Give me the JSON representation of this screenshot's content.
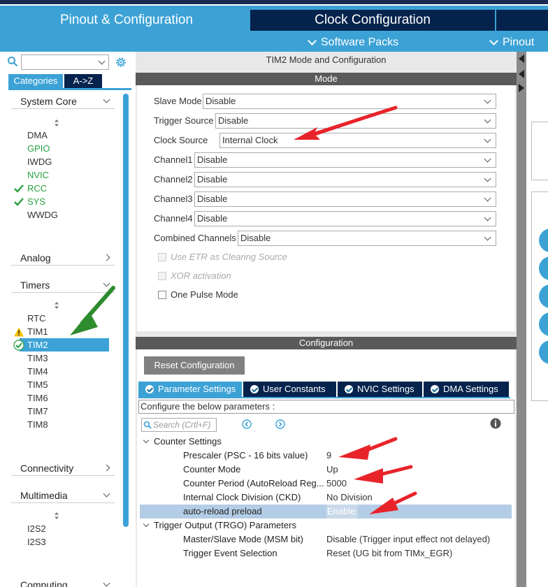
{
  "header": {
    "tab_pinout": "Pinout & Configuration",
    "tab_clock": "Clock Configuration",
    "sub_software_packs": "Software Packs",
    "sub_pinout": "Pinout"
  },
  "left_panel": {
    "search_value": "",
    "tab_categories": "Categories",
    "tab_az": "A->Z",
    "groups": {
      "system_core": "System Core",
      "analog": "Analog",
      "timers": "Timers",
      "connectivity": "Connectivity",
      "multimedia": "Multimedia",
      "computing": "Computing"
    },
    "system_core_items": [
      "DMA",
      "GPIO",
      "IWDG",
      "NVIC",
      "RCC",
      "SYS",
      "WWDG"
    ],
    "timer_items": [
      "RTC",
      "TIM1",
      "TIM2",
      "TIM3",
      "TIM4",
      "TIM5",
      "TIM6",
      "TIM7",
      "TIM8"
    ],
    "multimedia_items": [
      "I2S2",
      "I2S3"
    ]
  },
  "mode_panel": {
    "title": "TIM2 Mode and Configuration",
    "mode_header": "Mode",
    "fields": {
      "slave_mode": {
        "label": "Slave Mode",
        "value": "Disable"
      },
      "trigger_source": {
        "label": "Trigger Source",
        "value": "Disable"
      },
      "clock_source": {
        "label": "Clock Source",
        "value": "Internal Clock"
      },
      "channel1": {
        "label": "Channel1",
        "value": "Disable"
      },
      "channel2": {
        "label": "Channel2",
        "value": "Disable"
      },
      "channel3": {
        "label": "Channel3",
        "value": "Disable"
      },
      "channel4": {
        "label": "Channel4",
        "value": "Disable"
      },
      "combined_channels": {
        "label": "Combined Channels",
        "value": "Disable"
      }
    },
    "checkboxes": {
      "use_etr": "Use ETR as Clearing Source",
      "xor": "XOR activation",
      "one_pulse": "One Pulse Mode"
    }
  },
  "config_panel": {
    "header": "Configuration",
    "reset_button": "Reset Configuration",
    "tabs": {
      "parameter_settings": "Parameter Settings",
      "user_constants": "User Constants",
      "nvic_settings": "NVIC Settings",
      "dma_settings": "DMA Settings"
    },
    "configure_text": "Configure the below parameters :",
    "search_placeholder": "Search (Crtl+F)",
    "counter_settings": {
      "header": "Counter Settings",
      "rows": [
        {
          "name": "Prescaler (PSC - 16 bits value)",
          "value": "9"
        },
        {
          "name": "Counter Mode",
          "value": "Up"
        },
        {
          "name": "Counter Period (AutoReload Reg...",
          "value": "5000"
        },
        {
          "name": "Internal Clock Division (CKD)",
          "value": "No Division"
        },
        {
          "name": "auto-reload preload",
          "value": "Enable"
        }
      ]
    },
    "trigger_output": {
      "header": "Trigger Output (TRGO) Parameters",
      "rows": [
        {
          "name": "Master/Slave Mode (MSM bit)",
          "value": "Disable (Trigger input effect not delayed)"
        },
        {
          "name": "Trigger Event Selection",
          "value": "Reset (UG bit from TIMx_EGR)"
        }
      ]
    }
  },
  "colors": {
    "accent_blue": "#3ca2d6",
    "dark_navy": "#05234d",
    "annotation_red": "#e8242a",
    "annotation_green": "#2e8b2e",
    "check_green": "#26a040",
    "warning_yellow": "#f2c200"
  },
  "icons": [
    "search-icon",
    "gear-icon",
    "chevron-down-icon",
    "chevron-right-icon",
    "sort-icon",
    "check-icon",
    "warning-icon",
    "info-icon",
    "nav-prev-icon",
    "nav-next-icon"
  ]
}
